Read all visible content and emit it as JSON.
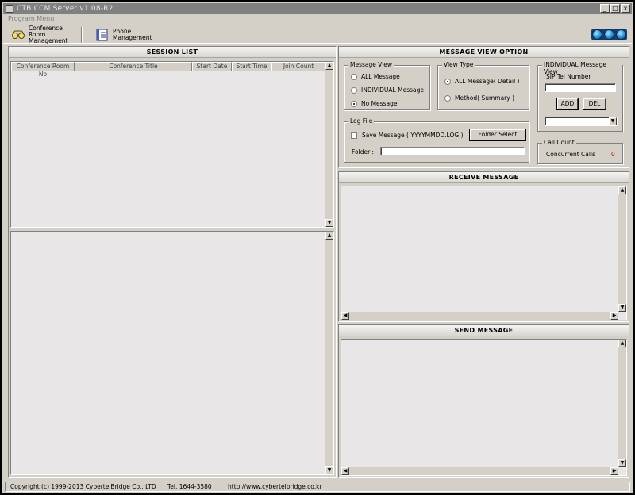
{
  "window": {
    "title": "CTB CCM Server v1.08-R2",
    "minimize": "_",
    "maximize": "□",
    "close": "x"
  },
  "menu": {
    "program_menu": "Program Menu"
  },
  "toolbar": {
    "conference": {
      "line1": "Conference Room",
      "line2": "Management",
      "icon": "glasses-icon"
    },
    "phone": {
      "line1": "Phone",
      "line2": "Management",
      "icon": "phonebook-icon"
    }
  },
  "session_list": {
    "title": "SESSION LIST",
    "columns": [
      "Conference Room No",
      "Conference Title",
      "Start Date",
      "Start Time",
      "Join Count"
    ],
    "rows": []
  },
  "message_view_option": {
    "title": "MESSAGE VIEW OPTION",
    "message_view": {
      "label": "Message View",
      "options": [
        "ALL Message",
        "INDIVIDUAL Message",
        "No Message"
      ],
      "selected": "No Message"
    },
    "view_type": {
      "label": "View Type",
      "options": [
        "ALL Message( Detail )",
        "Method( Summary )"
      ],
      "selected": "ALL Message( Detail )"
    },
    "individual": {
      "label": "INDIVIDUAL Message View",
      "sip_label": "SIP Tel Number",
      "sip_value": "",
      "add": "ADD",
      "del": "DEL",
      "combo_value": ""
    },
    "log_file": {
      "label": "Log File",
      "save_label": "Save Message ( YYYYMMDD.LOG )",
      "save_checked": false,
      "folder_select": "Folder Select",
      "folder_label": "Folder :",
      "folder_value": ""
    },
    "call_count": {
      "label": "Call Count",
      "concurrent_label": "Concurrent Calls",
      "concurrent_value": "0"
    }
  },
  "receive_message": {
    "title": "RECEIVE MESSAGE"
  },
  "send_message": {
    "title": "SEND MESSAGE"
  },
  "statusbar": {
    "copyright": "Copyright (c) 1999-2013 CybertelBridge Co., LTD",
    "tel": "Tel. 1644-3580",
    "url": "http://www.cybertelbridge.co.kr"
  },
  "colors": {
    "accent_red": "#c00000",
    "panel_bg": "#d4d0c8",
    "list_bg": "#e8e6e6"
  }
}
